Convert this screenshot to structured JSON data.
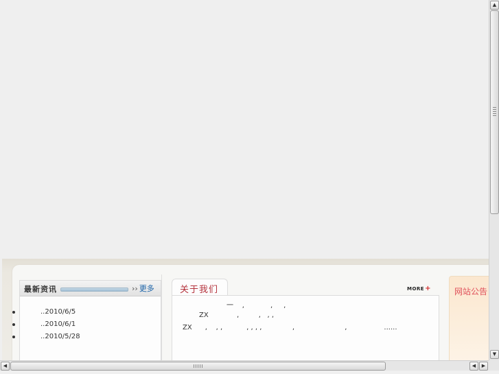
{
  "news": {
    "title": "最新资讯",
    "more_arrows": "››",
    "more_label": "更多",
    "items": [
      {
        "date": "..2010/6/5"
      },
      {
        "date": "..2010/6/1"
      },
      {
        "date": "..2010/5/28"
      }
    ]
  },
  "about": {
    "title": "关于我们",
    "more_label": "MORE",
    "more_plus": "+",
    "lines": [
      "一    ,            ,     ,",
      "ZX             ,         ,   , ,",
      "ZX      ,    , ,           , , , ,              ,                       ,                 ......"
    ]
  },
  "notice": {
    "title": "网站公告"
  },
  "scrollbars": {
    "up_arrow": "▲",
    "down_arrow": "▼",
    "left_arrow": "◀",
    "right_arrow": "▶"
  }
}
